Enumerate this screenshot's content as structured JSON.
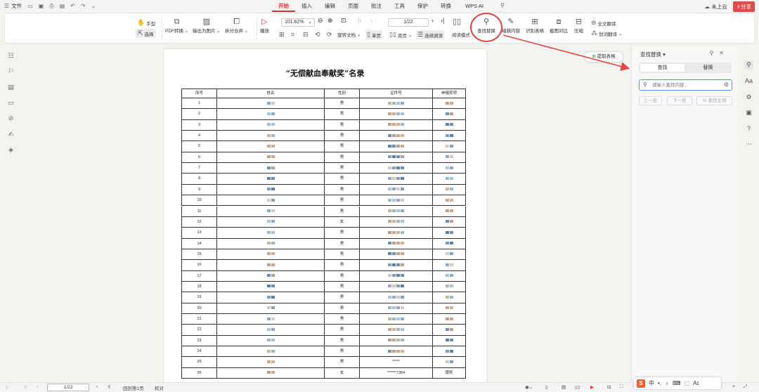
{
  "menu": {
    "file": "文件",
    "tabs": [
      "开始",
      "插入",
      "编辑",
      "页面",
      "批注",
      "工具",
      "保护",
      "转换",
      "WPS AI"
    ],
    "active_tab": "开始",
    "cloud": "未上云",
    "share": "分享"
  },
  "ribbon": {
    "hand": "手型",
    "select": "选择",
    "pdf_convert": "PDF转换",
    "export_image": "输出为图片",
    "split_merge": "拆分合并",
    "play": "播放",
    "zoom": "101.62%",
    "page": "1/22",
    "rotate": "旋转文档",
    "single_page": "单页",
    "double_page": "双页",
    "continuous": "连续阅读",
    "read_mode": "阅读模式",
    "find_replace": "查找替换",
    "edit_content": "编辑内容",
    "recognize_table": "识别表格",
    "screenshot_compare": "截图对比",
    "compress": "压缩",
    "full_translate": "全文翻译",
    "word_translate": "划词翻译"
  },
  "document": {
    "title": "“无偿献血奉献奖”名录",
    "headers": [
      "序号",
      "姓名",
      "性别",
      "证件号",
      "申报奖项"
    ],
    "rows": [
      {
        "n": "1",
        "g": "男"
      },
      {
        "n": "2",
        "g": "男"
      },
      {
        "n": "3",
        "g": "男"
      },
      {
        "n": "4",
        "g": "男"
      },
      {
        "n": "5",
        "g": "男"
      },
      {
        "n": "6",
        "g": "男"
      },
      {
        "n": "7",
        "g": "男"
      },
      {
        "n": "8",
        "g": "男"
      },
      {
        "n": "9",
        "g": "男"
      },
      {
        "n": "10",
        "g": "男"
      },
      {
        "n": "11",
        "g": "男"
      },
      {
        "n": "12",
        "g": "女"
      },
      {
        "n": "13",
        "g": "男"
      },
      {
        "n": "14",
        "g": "男"
      },
      {
        "n": "15",
        "g": "男"
      },
      {
        "n": "16",
        "g": "男"
      },
      {
        "n": "17",
        "g": "男"
      },
      {
        "n": "18",
        "g": "男"
      },
      {
        "n": "19",
        "g": "男"
      },
      {
        "n": "20",
        "g": "男"
      },
      {
        "n": "21",
        "g": "男"
      },
      {
        "n": "22",
        "g": "男"
      },
      {
        "n": "23",
        "g": "男"
      },
      {
        "n": "24",
        "g": "男"
      },
      {
        "n": "25",
        "g": "男",
        "id": "*****"
      },
      {
        "n": "26",
        "g": "女",
        "id": "******7384",
        "award": "银奖"
      }
    ]
  },
  "extract_table": "提取表格",
  "panel": {
    "title": "查找替换",
    "tab_find": "查找",
    "tab_replace": "替换",
    "search_placeholder": "请输入查找内容...",
    "prev": "上一处",
    "next": "下一处",
    "ai_find_all": "AI 查找全部"
  },
  "status": {
    "page": "1/22",
    "back_to_page": "回到第1页",
    "proofread": "校对"
  },
  "ime": {
    "lang": "中"
  },
  "colors": {
    "accent_red": "#d33333",
    "annotation_red": "#e04545",
    "input_focus": "#5b8def"
  }
}
